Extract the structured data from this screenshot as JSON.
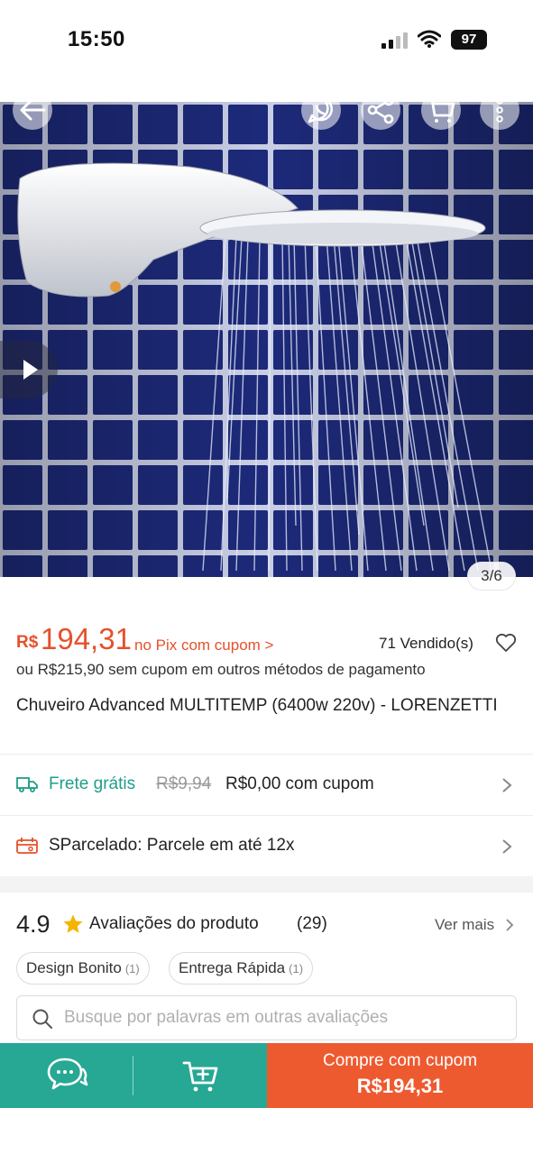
{
  "status_bar": {
    "time": "15:50",
    "battery": "97"
  },
  "gallery": {
    "counter": "3/6"
  },
  "price": {
    "currency": "R$",
    "amount": "194,31",
    "pix_note": "no Pix com cupom >",
    "sold": "71 Vendido(s)",
    "alt_price": "ou R$215,90 sem cupom em outros métodos de pagamento"
  },
  "product": {
    "title": "Chuveiro Advanced MULTITEMP (6400w 220v) - LORENZETTI"
  },
  "shipping": {
    "label": "Frete grátis",
    "old_price": "R$9,94",
    "new_price": "R$0,00 com cupom"
  },
  "installments": {
    "label": "SParcelado: Parcele em até 12x"
  },
  "reviews": {
    "rating": "4.9",
    "title": "Avaliações do produto",
    "count": "(29)",
    "see_more": "Ver mais",
    "tags": [
      {
        "label": "Design Bonito",
        "count": "(1)"
      },
      {
        "label": "Entrega Rápida",
        "count": "(1)"
      }
    ],
    "search_placeholder": "Busque por palavras em outras avaliações"
  },
  "bottom_bar": {
    "buy_line1": "Compre com cupom",
    "buy_line2": "R$194,31"
  },
  "colors": {
    "accent": "#ee5a30",
    "teal": "#26a894",
    "price": "#e5512b",
    "free_shipping": "#1f9e88",
    "tile_blue": "#1d2a7a"
  },
  "icons": [
    "back-arrow-icon",
    "whatsapp-share-icon",
    "share-icon",
    "cart-icon",
    "more-icon",
    "play-icon",
    "heart-icon",
    "truck-icon",
    "installment-icon",
    "chevron-right-icon",
    "star-icon",
    "search-icon",
    "chat-icon",
    "add-to-cart-icon"
  ]
}
